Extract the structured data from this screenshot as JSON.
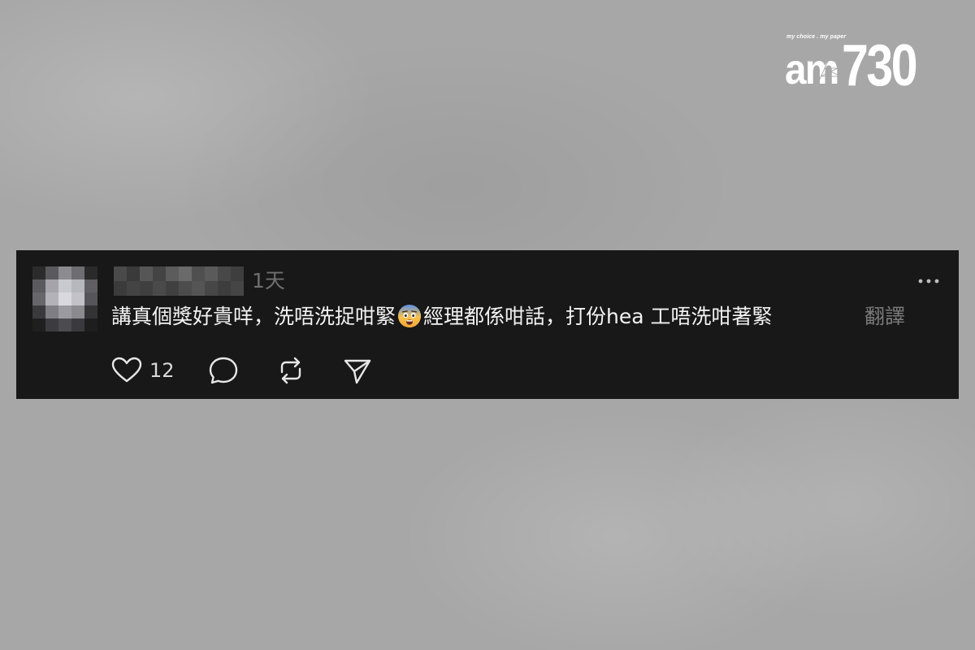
{
  "logo": {
    "tagline": "my choice . my paper",
    "am": "am",
    "number": "730"
  },
  "post": {
    "time_ago": "1天",
    "text_before_emoji": "講真個獎好貴咩，洗唔洗捉咁緊",
    "emoji": "fearful-face",
    "text_after_emoji": "經理都係咁話，打份hea 工唔洗咁著緊",
    "translate_label": "翻譯",
    "like_count": "12"
  },
  "icons": {
    "more": "more-horizontal-icon",
    "like": "heart-icon",
    "comment": "comment-bubble-icon",
    "repost": "repost-icon",
    "share": "send-icon"
  },
  "colors": {
    "background": "#a7a7a7",
    "card": "#181818",
    "text": "#f3f3f3",
    "muted": "#7a7a7a",
    "icon": "#e6e6e6"
  }
}
